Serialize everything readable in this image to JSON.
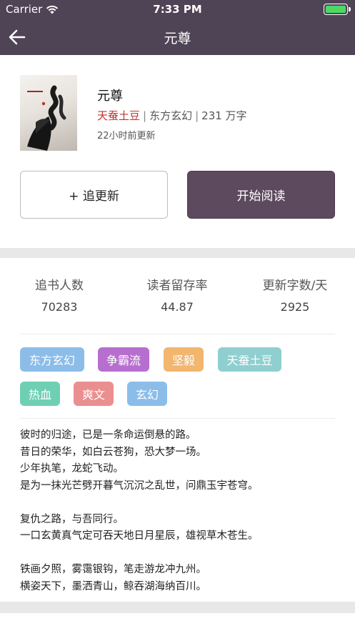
{
  "status_bar": {
    "carrier": "Carrier",
    "time": "7:33 PM"
  },
  "nav": {
    "title": "元尊",
    "back_icon": "arrow-left-icon"
  },
  "book": {
    "title": "元尊",
    "author": "天蚕土豆",
    "category": "东方玄幻",
    "word_count": "231 万字",
    "separator": "|",
    "updated": "22小时前更新"
  },
  "actions": {
    "follow_label": "+ 追更新",
    "read_label": "开始阅读"
  },
  "stats": [
    {
      "label": "追书人数",
      "value": "70283"
    },
    {
      "label": "读者留存率",
      "value": "44.87"
    },
    {
      "label": "更新字数/天",
      "value": "2925"
    }
  ],
  "tags": [
    {
      "label": "东方玄幻",
      "color": "#8cbde9"
    },
    {
      "label": "争霸流",
      "color": "#b76fcf"
    },
    {
      "label": "坚毅",
      "color": "#f2b66f"
    },
    {
      "label": "天蚕土豆",
      "color": "#8fcfd0"
    },
    {
      "label": "热血",
      "color": "#6fcfb3"
    },
    {
      "label": "爽文",
      "color": "#ea8f8f"
    },
    {
      "label": "玄幻",
      "color": "#8cbde9"
    }
  ],
  "intro": [
    "彼时的归途，已是一条命运倒悬的路。",
    "昔日的荣华，如白云苍狗，恐大梦一场。",
    "少年执笔，龙蛇飞动。",
    "是为一抹光芒劈开暮气沉沉之乱世，问鼎玉宇苍穹。",
    "",
    "复仇之路，与吾同行。",
    "一口玄黄真气定可吞天地日月星辰，雄视草木苍生。",
    "",
    "铁画夕照，雾霭银钩，笔走游龙冲九州。",
    "横姿天下，墨洒青山，鲸吞湖海纳百川。"
  ],
  "colors": {
    "header": "#4f4456",
    "read_button": "#5d4a5e",
    "author": "#c0312b"
  }
}
